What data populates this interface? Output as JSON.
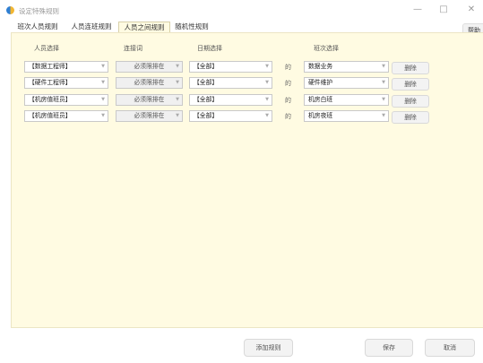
{
  "window": {
    "title": "设定特殊规则",
    "controls": {
      "minimize": "—",
      "maximize": "□",
      "close": "✕"
    }
  },
  "tabs": [
    {
      "label": "班次人员规则",
      "active": false
    },
    {
      "label": "人员连班规则",
      "active": false
    },
    {
      "label": "人员之间规则",
      "active": true
    },
    {
      "label": "随机性规则",
      "active": false
    }
  ],
  "help_label": "帮助",
  "columns": {
    "person": "人员选择",
    "connector": "连接词",
    "date": "日期选择",
    "shift": "班次选择"
  },
  "rows": [
    {
      "person": "【数据工程师】",
      "connector": "必须限排在",
      "date": "【全部】",
      "de": "的",
      "shift": "数据业务",
      "delete": "删除"
    },
    {
      "person": "【硬件工程师】",
      "connector": "必须限排在",
      "date": "【全部】",
      "de": "的",
      "shift": "硬件维护",
      "delete": "删除"
    },
    {
      "person": "【机房值班员】",
      "connector": "必须限排在",
      "date": "【全部】",
      "de": "的",
      "shift": "机房白班",
      "delete": "删除"
    },
    {
      "person": "【机房值班员】",
      "connector": "必须限排在",
      "date": "【全部】",
      "de": "的",
      "shift": "机房夜班",
      "delete": "删除"
    }
  ],
  "footer": {
    "add_rule": "添加规则",
    "save": "保存",
    "cancel": "取消"
  },
  "colors": {
    "panel_background": "#fffbe2",
    "app_icon_blue": "#2f7fd3",
    "app_icon_yellow": "#f2b632"
  }
}
